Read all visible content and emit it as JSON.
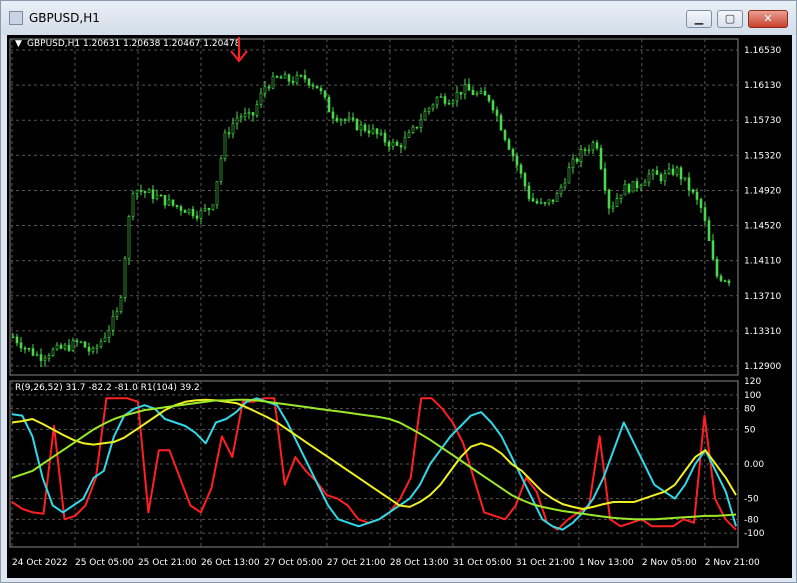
{
  "window": {
    "title": "GBPUSD,H1",
    "buttons": {
      "minimize": "▁",
      "maximize": "▢",
      "close": "✕"
    }
  },
  "header": {
    "symbol_info": "GBPUSD,H1  1.20631 1.20638 1.20467 1.20478",
    "indicator_info": "R(9,26,52) 31.7 -82.2 -81.0  R1(104) 39.2"
  },
  "price_axis": [
    "1.16530",
    "1.16130",
    "1.15730",
    "1.15320",
    "1.14920",
    "1.14520",
    "1.14110",
    "1.13710",
    "1.13310",
    "1.12900"
  ],
  "indicator_axis": [
    "120",
    "100",
    "80",
    "50",
    "0.00",
    "-50",
    "-80",
    "-100"
  ],
  "time_axis": [
    "24 Oct 2022",
    "25 Oct 05:00",
    "25 Oct 21:00",
    "26 Oct 13:00",
    "27 Oct 05:00",
    "27 Oct 21:00",
    "28 Oct 13:00",
    "31 Oct 05:00",
    "31 Oct 21:00",
    "1 Nov 13:00",
    "2 Nov 05:00",
    "2 Nov 21:00"
  ],
  "colors": {
    "background": "#000000",
    "candles": "#4cd64c",
    "red_line": "#ff2020",
    "cyan_line": "#30d8e8",
    "yellow_line": "#f0f020",
    "green_line": "#9be82a",
    "arrow": "#ff2020"
  },
  "icons": {
    "arrow_marker": "down-arrow-icon"
  },
  "chart_data": {
    "type": "line",
    "price_series": {
      "ylim": [
        1.127,
        1.1675
      ],
      "close_values": [
        1.1316,
        1.1302,
        1.1292,
        1.1299,
        1.1303,
        1.131,
        1.1296,
        1.132,
        1.1348,
        1.1495,
        1.149,
        1.1484,
        1.1475,
        1.147,
        1.1464,
        1.1473,
        1.1558,
        1.1583,
        1.158,
        1.1618,
        1.1628,
        1.1625,
        1.1628,
        1.1617,
        1.1585,
        1.1578,
        1.157,
        1.1565,
        1.1553,
        1.1545,
        1.156,
        1.1585,
        1.1604,
        1.1603,
        1.1615,
        1.1608,
        1.1603,
        1.1562,
        1.1524,
        1.1482,
        1.1473,
        1.1485,
        1.152,
        1.154,
        1.1552,
        1.147,
        1.1495,
        1.1498,
        1.1512,
        1.1508,
        1.1518,
        1.1495,
        1.1468,
        1.139,
        1.1385
      ]
    },
    "indicator_series": {
      "ylim": [
        -120,
        120
      ],
      "series": [
        {
          "name": "",
          "color": "red",
          "values": [
            -55,
            -65,
            -70,
            -72,
            55,
            -80,
            -75,
            -60,
            -20,
            95,
            95,
            95,
            90,
            -70,
            20,
            20,
            -20,
            -60,
            -70,
            -35,
            40,
            10,
            90,
            90,
            95,
            95,
            -30,
            10,
            -10,
            -25,
            -45,
            -50,
            -60,
            -80,
            -85,
            -80,
            -70,
            -50,
            -20,
            95,
            95,
            80,
            60,
            30,
            -20,
            -70,
            -75,
            -80,
            -60,
            -20,
            -40,
            -85,
            -95,
            -80,
            -70,
            -60,
            40,
            -80,
            -90,
            -85,
            -80,
            -90,
            -90,
            -90,
            -80,
            -85,
            70,
            -50,
            -80,
            -95
          ]
        },
        {
          "name": "",
          "color": "cyan",
          "values": [
            72,
            70,
            40,
            -20,
            -60,
            -70,
            -60,
            -50,
            -20,
            -10,
            40,
            70,
            80,
            85,
            80,
            65,
            60,
            55,
            45,
            30,
            60,
            65,
            75,
            90,
            95,
            90,
            85,
            60,
            30,
            0,
            -30,
            -60,
            -80,
            -85,
            -90,
            -85,
            -80,
            -70,
            -60,
            -50,
            -30,
            0,
            20,
            40,
            55,
            70,
            75,
            60,
            40,
            10,
            -20,
            -50,
            -80,
            -90,
            -95,
            -85,
            -70,
            -50,
            -20,
            20,
            60,
            30,
            0,
            -30,
            -40,
            -50,
            -30,
            0,
            20,
            -10,
            -40,
            -90
          ]
        },
        {
          "name": "",
          "color": "yellow",
          "values": [
            60,
            62,
            65,
            58,
            50,
            42,
            35,
            30,
            28,
            30,
            32,
            38,
            48,
            58,
            68,
            78,
            85,
            90,
            92,
            93,
            92,
            90,
            88,
            82,
            75,
            68,
            60,
            50,
            40,
            30,
            20,
            10,
            0,
            -10,
            -20,
            -30,
            -40,
            -50,
            -60,
            -62,
            -55,
            -45,
            -30,
            -10,
            10,
            25,
            30,
            25,
            15,
            0,
            -10,
            -25,
            -40,
            -50,
            -58,
            -62,
            -65,
            -62,
            -58,
            -55,
            -55,
            -55,
            -50,
            -45,
            -40,
            -30,
            -10,
            10,
            20,
            0,
            -20,
            -45
          ]
        },
        {
          "name": "",
          "color": "green",
          "values": [
            -20,
            -15,
            -10,
            0,
            10,
            20,
            30,
            40,
            50,
            58,
            65,
            70,
            74,
            78,
            80,
            82,
            84,
            86,
            88,
            90,
            92,
            92,
            93,
            93,
            92,
            90,
            88,
            86,
            84,
            82,
            80,
            78,
            76,
            74,
            72,
            70,
            68,
            65,
            60,
            52,
            44,
            35,
            25,
            15,
            5,
            -5,
            -15,
            -25,
            -35,
            -45,
            -52,
            -58,
            -62,
            -65,
            -68,
            -70,
            -72,
            -74,
            -76,
            -78,
            -79,
            -80,
            -80,
            -80,
            -79,
            -78,
            -77,
            -76,
            -75,
            -75,
            -74,
            -73
          ]
        }
      ]
    }
  }
}
